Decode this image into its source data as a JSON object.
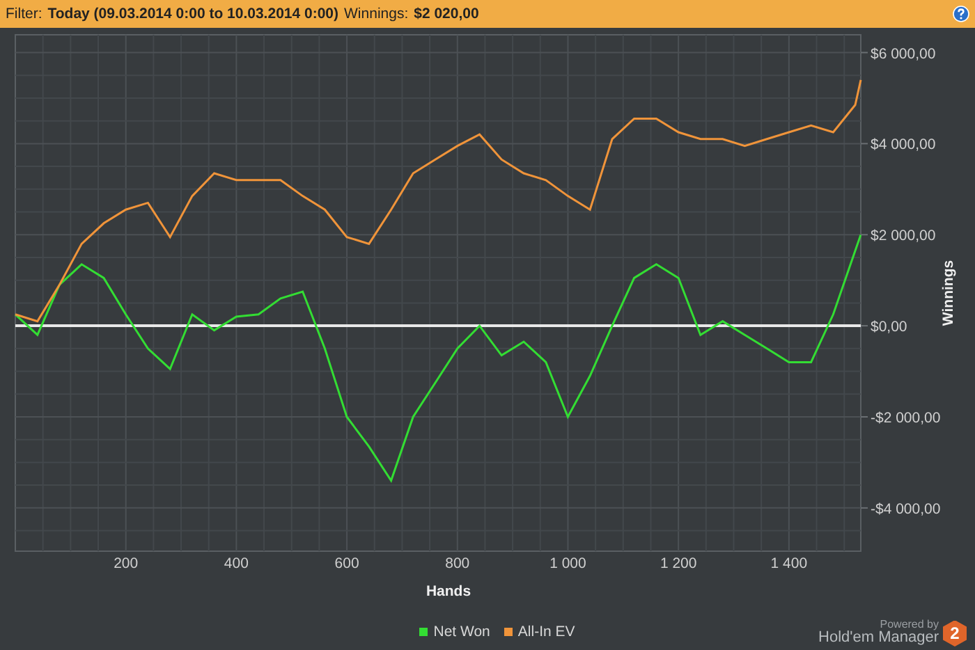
{
  "filter_bar": {
    "filter_label": "Filter:",
    "filter_value": "Today (09.03.2014 0:00 to 10.03.2014 0:00)",
    "winnings_label": "Winnings:",
    "winnings_value": "$2 020,00"
  },
  "chart": {
    "chart_data": {
      "type": "line",
      "grid": true,
      "xlabel": "Hands",
      "ylabel": "Winnings",
      "xlim": [
        0,
        1530
      ],
      "ylim": [
        -4950,
        6390
      ],
      "x": [
        0,
        40,
        80,
        120,
        160,
        200,
        240,
        280,
        320,
        360,
        400,
        440,
        480,
        520,
        560,
        600,
        640,
        680,
        720,
        760,
        800,
        840,
        880,
        920,
        960,
        1000,
        1040,
        1080,
        1120,
        1160,
        1200,
        1240,
        1280,
        1320,
        1360,
        1400,
        1440,
        1480,
        1520,
        1530
      ],
      "xticks": [
        200,
        400,
        600,
        800,
        {
          "value": 1000,
          "label": "1 000"
        },
        {
          "value": 1200,
          "label": "1 200"
        },
        {
          "value": 1400,
          "label": "1 400"
        }
      ],
      "yticks": [
        {
          "value": -4000,
          "label": "-$4 000,00"
        },
        {
          "value": -2000,
          "label": "-$2 000,00"
        },
        {
          "value": 0,
          "label": "$0,00"
        },
        {
          "value": 2000,
          "label": "$2 000,00"
        },
        {
          "value": 4000,
          "label": "$4 000,00"
        },
        {
          "value": 6000,
          "label": "$6 000,00"
        }
      ],
      "series": [
        {
          "name": "Net Won",
          "color": "#33dd33",
          "values": [
            250,
            -200,
            900,
            1350,
            1050,
            250,
            -500,
            -950,
            250,
            -100,
            200,
            250,
            600,
            750,
            -500,
            -2000,
            -2650,
            -3400,
            -2000,
            -1250,
            -500,
            0,
            -650,
            -350,
            -800,
            -2000,
            -1100,
            0,
            1050,
            1350,
            1050,
            -200,
            100,
            -200,
            -500,
            -800,
            -800,
            250,
            1650,
            2000
          ]
        },
        {
          "name": "All-In EV",
          "color": "#f0943a",
          "values": [
            250,
            100,
            900,
            1800,
            2250,
            2550,
            2700,
            1950,
            2850,
            3350,
            3200,
            3200,
            3200,
            2850,
            2550,
            1950,
            1800,
            2550,
            3350,
            3650,
            3950,
            4200,
            3650,
            3350,
            3200,
            2850,
            2550,
            4100,
            4550,
            4550,
            4250,
            4100,
            4100,
            3950,
            4100,
            4250,
            4400,
            4250,
            4850,
            5400
          ]
        }
      ]
    }
  },
  "branding": {
    "powered_by": "Powered by",
    "product": "Hold'em Manager",
    "version_badge": "2"
  }
}
